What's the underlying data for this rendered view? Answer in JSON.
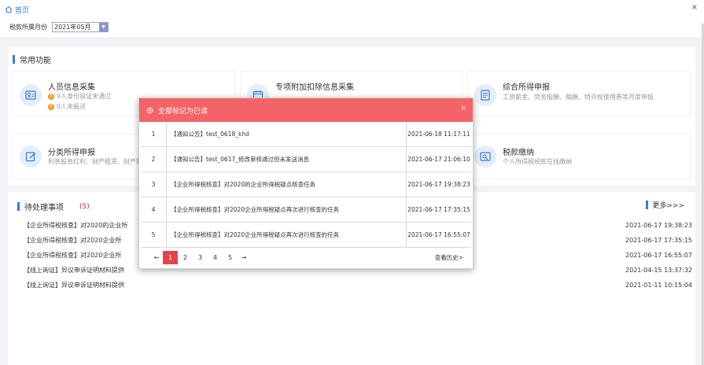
{
  "topbar": {
    "breadcrumb_home": "首页",
    "close_glyph": "×",
    "month_label": "税款所属月份",
    "month_value": "2021年05月"
  },
  "common": {
    "title": "常用功能",
    "cards": [
      {
        "title": "人员信息采集",
        "warn1": "9人身份验证未通过",
        "warn2": "0人未报送",
        "icon": "id-card-icon"
      },
      {
        "title": "专项附加扣除信息采集",
        "icon": "calendar-icon"
      },
      {
        "title": "综合所得申报",
        "sub": "工资薪金、劳务报酬、稿酬、特许权使用费等月度申报",
        "icon": "document-icon"
      },
      {
        "title": "分类所得申报",
        "sub": "利息股息红利、财产租赁、财产转",
        "icon": "edit-icon"
      },
      {
        "title": "税款缴纳",
        "sub": "个人所得税税款在线缴纳",
        "icon": "payment-icon"
      }
    ]
  },
  "pending": {
    "title": "待处理事项",
    "count": "(5)",
    "more": "更多>>>",
    "items": [
      {
        "text": "【企业所得税核查】对2020的企业所",
        "date": "2021-06-17 19:38:23"
      },
      {
        "text": "【企业所得税核查】对2020企业所",
        "date": "2021-06-17 17:35:15"
      },
      {
        "text": "【企业所得税核查】对2020企业所",
        "date": "2021-06-17 16:55:07"
      },
      {
        "text": "【线上询证】异议申诉证明材料提供",
        "date": "2021-04-15 13:37:32"
      },
      {
        "text": "【线上询证】异议申诉证明材料提供",
        "date": "2021-01-11 10:15:04"
      }
    ]
  },
  "modal": {
    "header": "全部标记为已读",
    "close_glyph": "×",
    "rows": [
      {
        "num": "1",
        "title": "【通知公告】test_0618_khd",
        "date": "2021-06-18 11:17:11"
      },
      {
        "num": "2",
        "title": "【通知公告】test_0617_修改审核通过但未发送消息",
        "date": "2021-06-17 21:06:10"
      },
      {
        "num": "3",
        "title": "【企业所得税核查】对2020的企业所得税疑点核查任务",
        "date": "2021-06-17 19:38:23"
      },
      {
        "num": "4",
        "title": "【企业所得税核查】对2020企业所得税疑点再次进行核查的任务",
        "date": "2021-06-17 17:35:15"
      },
      {
        "num": "5",
        "title": "【企业所得税核查】对2020企业所得税疑点再次进行核查的任务",
        "date": "2021-06-17 16:55:07"
      }
    ],
    "pager": {
      "prev": "←",
      "next": "→",
      "pages": [
        "1",
        "2",
        "3",
        "4",
        "5"
      ],
      "active": "1",
      "history": "查看历史>"
    }
  },
  "colors": {
    "accent": "#3a7bd5",
    "modal_header": "#f46466",
    "active_page": "#e9434b",
    "warn": "#f29c1f"
  }
}
